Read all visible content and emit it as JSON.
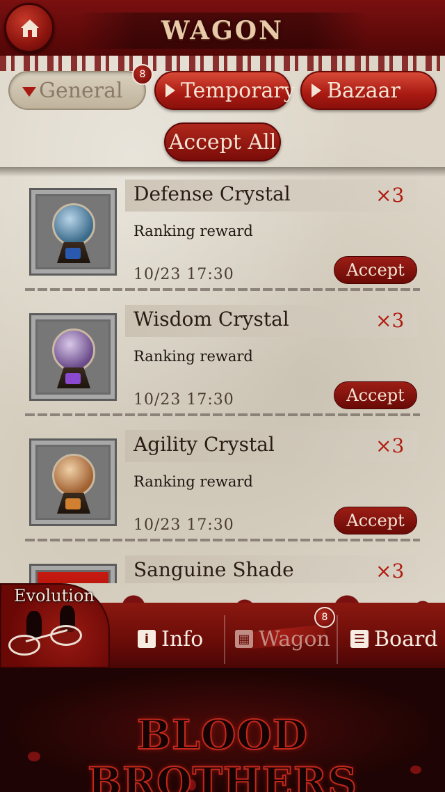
{
  "header": {
    "title": "WAGON",
    "home_icon": "home-icon"
  },
  "tabs": [
    {
      "label": "General",
      "active": true,
      "badge": "8"
    },
    {
      "label": "Temporary",
      "active": false
    },
    {
      "label": "Bazaar",
      "active": false
    }
  ],
  "accept_all_label": "Accept All",
  "items": [
    {
      "name": "Defense Crystal",
      "qty": "×3",
      "reason": "Ranking reward",
      "date": "10/23 17:30",
      "accept": "Accept",
      "orb_color": "#3a6a8a",
      "gem_color": "#2a5ab0"
    },
    {
      "name": "Wisdom Crystal",
      "qty": "×3",
      "reason": "Ranking reward",
      "date": "10/23 17:30",
      "accept": "Accept",
      "orb_color": "#6a4a8a",
      "gem_color": "#8a4ad0"
    },
    {
      "name": "Agility Crystal",
      "qty": "×3",
      "reason": "Ranking reward",
      "date": "10/23 17:30",
      "accept": "Accept",
      "orb_color": "#a06030",
      "gem_color": "#d08030"
    },
    {
      "name": "Sanguine Shade",
      "qty": "×3"
    }
  ],
  "bottom_nav": {
    "evolution": "Evolution",
    "info": "Info",
    "wagon": "Wagon",
    "wagon_badge": "8",
    "board": "Board"
  },
  "banner": {
    "title": "BLOOD BROTHERS"
  },
  "colors": {
    "accent_red": "#a81a12",
    "parchment": "#ddd6c8",
    "qty_red": "#b01a10"
  }
}
